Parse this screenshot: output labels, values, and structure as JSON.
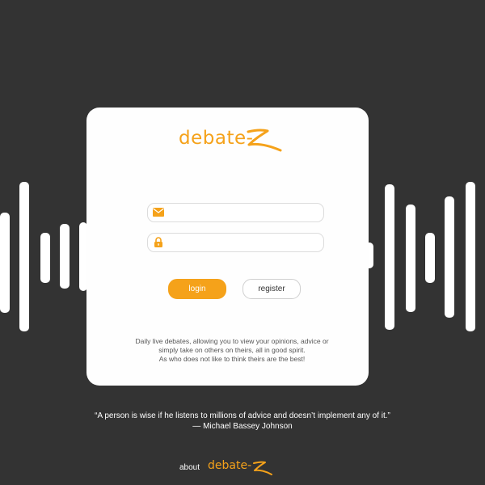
{
  "brand": {
    "name": "debate-",
    "accent_color": "#f5a21a"
  },
  "login_form": {
    "email_icon": "envelope-icon",
    "password_icon": "lock-icon",
    "email_value": "",
    "password_value": "",
    "login_label": "login",
    "register_label": "register"
  },
  "description": {
    "line1": "Daily live debates, allowing you to view your opinions, advice or",
    "line2": "simply take on others on theirs, all in good spirit.",
    "line3": "As who does not like to think theirs are the best!"
  },
  "quote": {
    "text": "“A person is wise if he listens to millions of advice and doesn’t implement any of it.”",
    "author": "— Michael Bassey Johnson"
  },
  "footer": {
    "about_label": "about",
    "brand_name": "debate-"
  },
  "colors": {
    "background": "#333333",
    "card": "#fefefe"
  }
}
